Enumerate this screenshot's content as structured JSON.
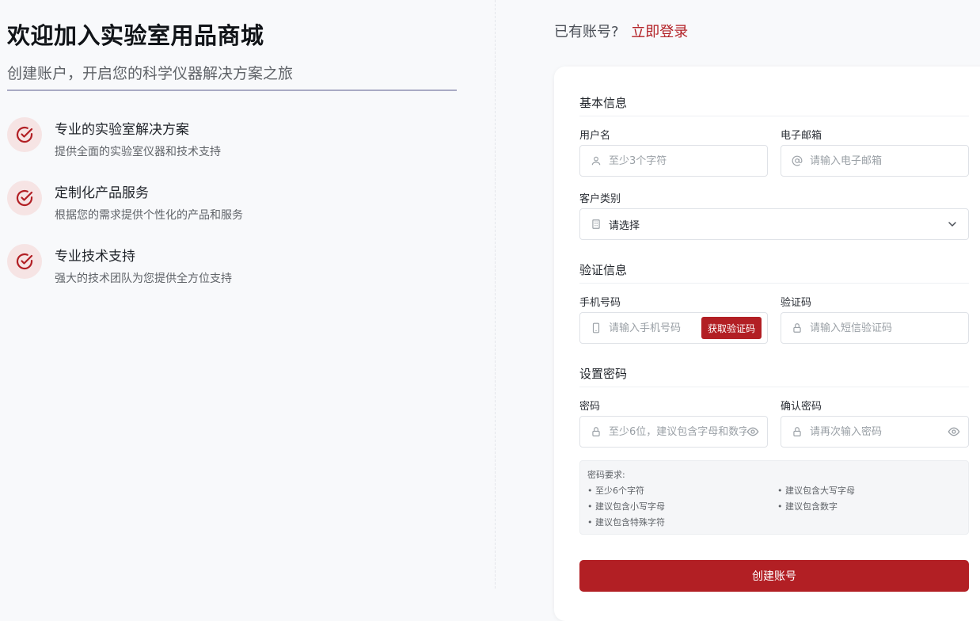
{
  "hero": {
    "title": "欢迎加入实验室用品商城",
    "subtitle": "创建账户，开启您的科学仪器解决方案之旅",
    "features": [
      {
        "title": "专业的实验室解决方案",
        "desc": "提供全面的实验室仪器和技术支持",
        "icon": "check-circle-icon"
      },
      {
        "title": "定制化产品服务",
        "desc": "根据您的需求提供个性化的产品和服务",
        "icon": "check-circle-icon"
      },
      {
        "title": "专业技术支持",
        "desc": "强大的技术团队为您提供全方位支持",
        "icon": "check-circle-icon"
      }
    ]
  },
  "login": {
    "prompt": "已有账号?",
    "link": "立即登录"
  },
  "form": {
    "basic": {
      "title": "基本信息",
      "username_label": "用户名",
      "username_placeholder": "至少3个字符",
      "email_label": "电子邮箱",
      "email_placeholder": "请输入电子邮箱",
      "customer_type_label": "客户类别",
      "customer_type_value": "请选择"
    },
    "verify": {
      "title": "验证信息",
      "phone_label": "手机号码",
      "phone_placeholder": "请输入手机号码",
      "get_code_label": "获取验证码",
      "code_label": "验证码",
      "code_placeholder": "请输入短信验证码"
    },
    "password": {
      "title": "设置密码",
      "password_label": "密码",
      "password_placeholder": "至少6位，建议包含字母和数字",
      "confirm_label": "确认密码",
      "confirm_placeholder": "请再次输入密码"
    },
    "requirements": {
      "title": "密码要求:",
      "items": [
        "至少6个字符",
        "建议包含大写字母",
        "建议包含小写字母",
        "建议包含数字",
        "建议包含特殊字符"
      ]
    },
    "submit_label": "创建账号"
  },
  "colors": {
    "accent": "#b21f24",
    "background": "#f8f9fb"
  }
}
